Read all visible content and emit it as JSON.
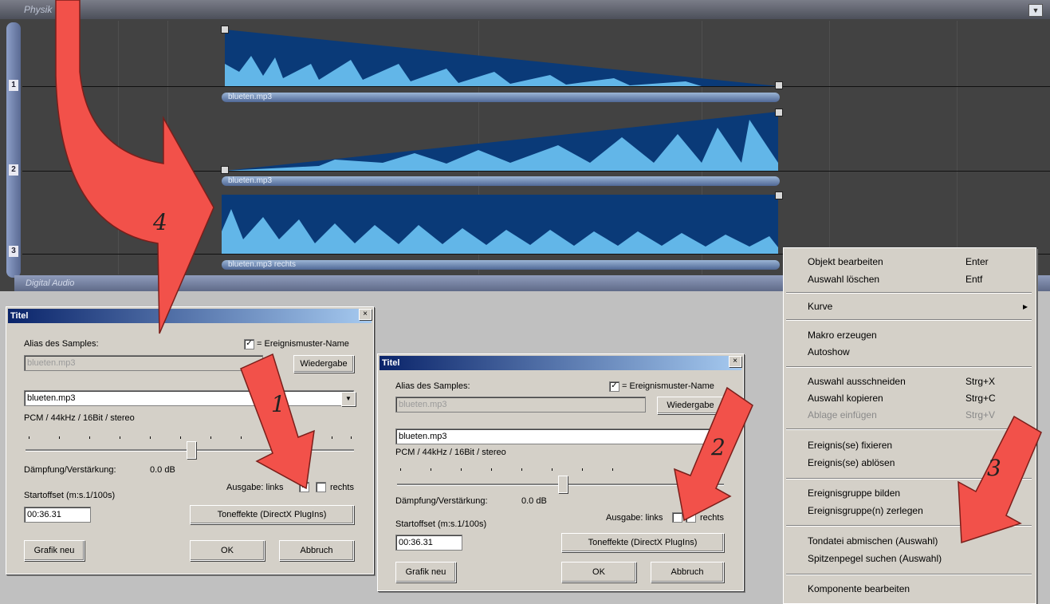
{
  "editor": {
    "header_title": "Physik",
    "footer_label": "Digital Audio",
    "tracks": [
      "1",
      "2",
      "3"
    ],
    "clips": [
      {
        "name": "blueten.mp3"
      },
      {
        "name": "blueten.mp3"
      },
      {
        "name": "blueten.mp3 rechts"
      }
    ],
    "colors": {
      "wave_dark": "#0a3a78",
      "wave_light": "#62b6e8",
      "bg": "#424242"
    }
  },
  "dialog1": {
    "title": "Titel",
    "close": "×",
    "alias_label": "Alias des Samples:",
    "alias_value": "blueten.mp3",
    "eventname_label": "= Ereignismuster-Name",
    "play_button": "Wiedergabe",
    "file_select": "blueten.mp3",
    "format_text": "PCM / 44kHz / 16Bit / stereo",
    "gain_label": "Dämpfung/Verstärkung:",
    "gain_value": "0.0 dB",
    "output_label": "Ausgabe: links",
    "right_label": "rechts",
    "startoffset_label": "Startoffset (m:s.1/100s)",
    "startoffset_value": "00:36.31",
    "effects_button": "Toneffekte (DirectX PlugIns)",
    "redraw_button": "Grafik neu",
    "ok_button": "OK",
    "cancel_button": "Abbruch",
    "left_checked": true,
    "right_checked": false
  },
  "dialog2": {
    "title": "Titel",
    "close": "×",
    "alias_label": "Alias des Samples:",
    "alias_value": "blueten.mp3",
    "eventname_label": "= Ereignismuster-Name",
    "play_button": "Wiedergabe",
    "file_select": "blueten.mp3",
    "format_text": "PCM / 44kHz / 16Bit / stereo",
    "gain_label": "Dämpfung/Verstärkung:",
    "gain_value": "0.0 dB",
    "output_label": "Ausgabe: links",
    "right_label": "rechts",
    "startoffset_label": "Startoffset (m:s.1/100s)",
    "startoffset_value": "00:36.31",
    "effects_button": "Toneffekte (DirectX PlugIns)",
    "redraw_button": "Grafik neu",
    "ok_button": "OK",
    "cancel_button": "Abbruch",
    "left_checked": false,
    "right_checked": true
  },
  "context_menu": {
    "items": [
      {
        "label": "Objekt bearbeiten",
        "shortcut": "Enter"
      },
      {
        "label": "Auswahl löschen",
        "shortcut": "Entf"
      },
      {
        "label": "Kurve",
        "shortcut": ""
      },
      {
        "label": "Makro erzeugen",
        "shortcut": ""
      },
      {
        "label": "Autoshow",
        "shortcut": ""
      },
      {
        "label": "Auswahl ausschneiden",
        "shortcut": "Strg+X"
      },
      {
        "label": "Auswahl kopieren",
        "shortcut": "Strg+C"
      },
      {
        "label": "Ablage einfügen",
        "shortcut": "Strg+V"
      },
      {
        "label": "Ereignis(se) fixieren",
        "shortcut": ""
      },
      {
        "label": "Ereignis(se) ablösen",
        "shortcut": ""
      },
      {
        "label": "Ereignisgruppe bilden",
        "shortcut": ""
      },
      {
        "label": "Ereignisgruppe(n) zerlegen",
        "shortcut": ""
      },
      {
        "label": "Tondatei abmischen (Auswahl)",
        "shortcut": ""
      },
      {
        "label": "Spitzenpegel suchen (Auswahl)",
        "shortcut": ""
      },
      {
        "label": "Komponente bearbeiten",
        "shortcut": ""
      }
    ],
    "submenu_arrow": "▸"
  },
  "annotations": {
    "numbers": [
      "1",
      "2",
      "3",
      "4"
    ],
    "arrow_color": "#f2514a"
  }
}
